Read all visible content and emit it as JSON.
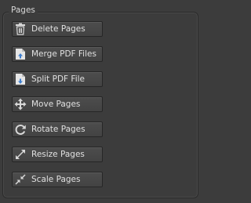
{
  "panel": {
    "title": "Pages",
    "buttons": [
      {
        "id": "delete-pages",
        "label": "Delete Pages",
        "icon": "trash-icon"
      },
      {
        "id": "merge-pdf-files",
        "label": "Merge PDF Files",
        "icon": "merge-icon"
      },
      {
        "id": "split-pdf-file",
        "label": "Split PDF File",
        "icon": "split-icon"
      },
      {
        "id": "move-pages",
        "label": "Move Pages",
        "icon": "move-icon"
      },
      {
        "id": "rotate-pages",
        "label": "Rotate Pages",
        "icon": "rotate-icon"
      },
      {
        "id": "resize-pages",
        "label": "Resize Pages",
        "icon": "resize-icon"
      },
      {
        "id": "scale-pages",
        "label": "Scale Pages",
        "icon": "scale-icon"
      }
    ]
  },
  "colors": {
    "background": "#3c3c3c",
    "button": "#474747",
    "text": "#e0e0e0"
  }
}
